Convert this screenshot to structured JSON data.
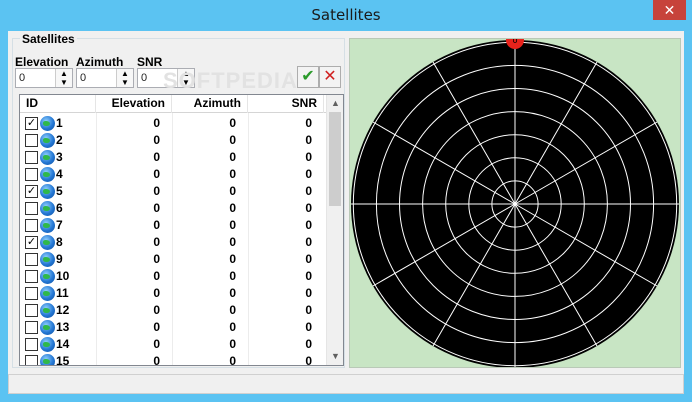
{
  "window": {
    "title": "Satellites",
    "close_glyph": "✕"
  },
  "group": {
    "caption": "Satellites"
  },
  "fields": {
    "elevation": {
      "label": "Elevation",
      "value": "0"
    },
    "azimuth": {
      "label": "Azimuth",
      "value": "0"
    },
    "snr": {
      "label": "SNR",
      "value": "0"
    }
  },
  "buttons": {
    "ok_glyph": "✔",
    "cancel_glyph": "✕"
  },
  "watermark": "SOFTPEDIA",
  "table": {
    "headers": [
      "ID",
      "Elevation",
      "Azimuth",
      "SNR"
    ],
    "rows": [
      {
        "id": "1",
        "checked": true,
        "elevation": "0",
        "azimuth": "0",
        "snr": "0"
      },
      {
        "id": "2",
        "checked": false,
        "elevation": "0",
        "azimuth": "0",
        "snr": "0"
      },
      {
        "id": "3",
        "checked": false,
        "elevation": "0",
        "azimuth": "0",
        "snr": "0"
      },
      {
        "id": "4",
        "checked": false,
        "elevation": "0",
        "azimuth": "0",
        "snr": "0"
      },
      {
        "id": "5",
        "checked": true,
        "elevation": "0",
        "azimuth": "0",
        "snr": "0"
      },
      {
        "id": "6",
        "checked": false,
        "elevation": "0",
        "azimuth": "0",
        "snr": "0"
      },
      {
        "id": "7",
        "checked": false,
        "elevation": "0",
        "azimuth": "0",
        "snr": "0"
      },
      {
        "id": "8",
        "checked": true,
        "elevation": "0",
        "azimuth": "0",
        "snr": "0"
      },
      {
        "id": "9",
        "checked": false,
        "elevation": "0",
        "azimuth": "0",
        "snr": "0"
      },
      {
        "id": "10",
        "checked": false,
        "elevation": "0",
        "azimuth": "0",
        "snr": "0"
      },
      {
        "id": "11",
        "checked": false,
        "elevation": "0",
        "azimuth": "0",
        "snr": "0"
      },
      {
        "id": "12",
        "checked": false,
        "elevation": "0",
        "azimuth": "0",
        "snr": "0"
      },
      {
        "id": "13",
        "checked": false,
        "elevation": "0",
        "azimuth": "0",
        "snr": "0"
      },
      {
        "id": "14",
        "checked": false,
        "elevation": "0",
        "azimuth": "0",
        "snr": "0"
      },
      {
        "id": "15",
        "checked": false,
        "elevation": "0",
        "azimuth": "0",
        "snr": "0"
      }
    ]
  },
  "radar": {
    "background_color": "#000000",
    "grid_color": "#ffffff",
    "panel_color": "#c8e5c4",
    "satellite_marker_color": "#e8231c",
    "ring_count": 7,
    "spoke_count": 12,
    "marker_label": "0",
    "marker_azimuth_deg": 0,
    "marker_elevation_deg": 0
  },
  "colors": {
    "titlebar": "#5bc3f2",
    "close_button": "#c7433b"
  }
}
